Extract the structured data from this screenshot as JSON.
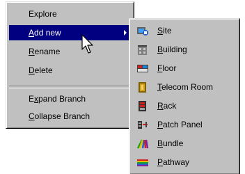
{
  "context_menu": {
    "items": [
      {
        "label": "Explore",
        "hotkey": "",
        "rest": "Explore",
        "pre": ""
      },
      {
        "label": "Add new",
        "hotkey": "A",
        "rest": "dd new",
        "pre": ""
      },
      {
        "label": "Rename",
        "hotkey": "R",
        "rest": "ename",
        "pre": ""
      },
      {
        "label": "Delete",
        "hotkey": "D",
        "rest": "elete",
        "pre": ""
      },
      {
        "label": "Expand Branch",
        "hotkey": "x",
        "rest": "pand Branch",
        "pre": "E"
      },
      {
        "label": "Collapse Branch",
        "hotkey": "C",
        "rest": "ollapse Branch",
        "pre": ""
      }
    ],
    "highlighted_item": "Add new",
    "highlight_color": "#000080"
  },
  "submenu": {
    "items": [
      {
        "label": "Site",
        "hotkey": "S",
        "rest": "ite",
        "icon": "site-icon"
      },
      {
        "label": "Building",
        "hotkey": "B",
        "rest": "uilding",
        "icon": "building-icon"
      },
      {
        "label": "Floor",
        "hotkey": "F",
        "rest": "loor",
        "icon": "floor-icon"
      },
      {
        "label": "Telecom Room",
        "hotkey": "T",
        "rest": "elecom Room",
        "icon": "telecom-room-icon"
      },
      {
        "label": "Rack",
        "hotkey": "R",
        "rest": "ack",
        "icon": "rack-icon"
      },
      {
        "label": "Patch Panel",
        "hotkey": "P",
        "rest": "atch Panel",
        "icon": "patch-panel-icon"
      },
      {
        "label": "Bundle",
        "hotkey": "B",
        "rest": "undle",
        "icon": "bundle-icon"
      },
      {
        "label": "Pathway",
        "hotkey": "P",
        "rest": "athway",
        "icon": "pathway-icon"
      }
    ]
  },
  "colors": {
    "menu_face": "#c0c0c0",
    "highlight": "#000080",
    "highlight_text": "#ffffff"
  }
}
